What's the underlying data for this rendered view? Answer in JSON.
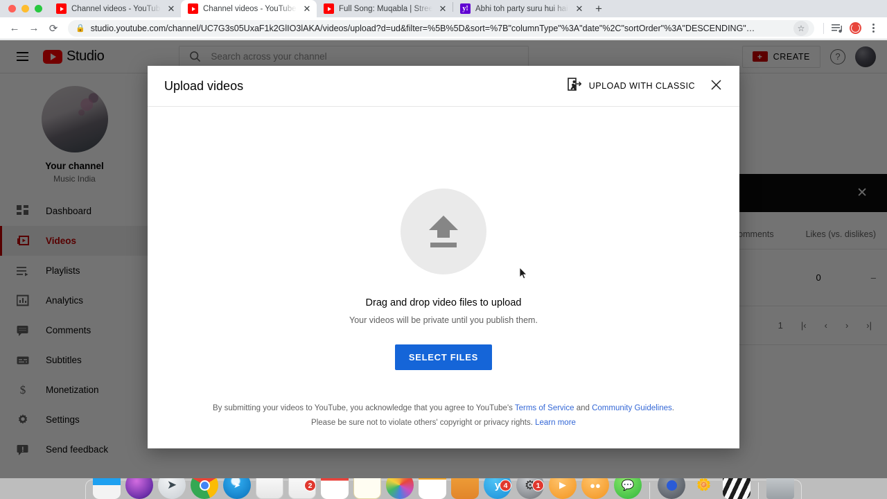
{
  "browser": {
    "tabs": [
      {
        "title": "Channel videos - YouTube Stud",
        "favicon": "youtube-icon",
        "active": false
      },
      {
        "title": "Channel videos - YouTube Stud",
        "favicon": "youtube-icon",
        "active": true
      },
      {
        "title": "Full Song: Muqabla | Street Dan",
        "favicon": "youtube-icon",
        "active": false
      },
      {
        "title": "Abhi toh party suru hui hai - Ya",
        "favicon": "yahoo-icon",
        "active": false
      }
    ],
    "new_tab_label": "+",
    "close_label": "✕",
    "back_label": "←",
    "forward_label": "→",
    "reload_label": "⟳",
    "url": "studio.youtube.com/channel/UC7G3s05UxaF1k2GlIO3lAKA/videos/upload?d=ud&filter=%5B%5D&sort=%7B\"columnType\"%3A\"date\"%2C\"sortOrder\"%3A\"DESCENDING\"…",
    "star_label": "☆",
    "reading_list_label": "☰",
    "profile_label": "",
    "menu_label": ""
  },
  "studio": {
    "logo_text": "Studio",
    "search_placeholder": "Search across your channel",
    "create_label": "CREATE",
    "help_label": "?",
    "channel": {
      "title": "Your channel",
      "name": "Music India"
    },
    "nav": [
      {
        "label": "Dashboard",
        "icon": "dashboard-icon",
        "active": false
      },
      {
        "label": "Videos",
        "icon": "video-icon",
        "active": true
      },
      {
        "label": "Playlists",
        "icon": "playlist-icon",
        "active": false
      },
      {
        "label": "Analytics",
        "icon": "analytics-icon",
        "active": false
      },
      {
        "label": "Comments",
        "icon": "comments-icon",
        "active": false
      },
      {
        "label": "Subtitles",
        "icon": "subtitles-icon",
        "active": false
      },
      {
        "label": "Monetization",
        "icon": "dollar-icon",
        "active": false
      },
      {
        "label": "Settings",
        "icon": "gear-icon",
        "active": false
      },
      {
        "label": "Send feedback",
        "icon": "feedback-icon",
        "active": false
      }
    ],
    "table": {
      "banner_close": "✕",
      "columns": [
        "Comments",
        "Likes (vs. dislikes)"
      ],
      "row": [
        "0",
        "–"
      ],
      "page_number": "1",
      "pager": [
        "|‹",
        "‹",
        "›",
        "›|"
      ]
    }
  },
  "modal": {
    "title": "Upload videos",
    "classic_label": "UPLOAD WITH CLASSIC",
    "classic_icon": "exit-to-app-icon",
    "close_icon": "close-icon",
    "upload_icon": "upload-arrow-icon",
    "drop_title": "Drag and drop video files to upload",
    "drop_subtitle": "Your videos will be private until you publish them.",
    "select_button": "SELECT FILES",
    "legal_line1_prefix": "By submitting your videos to YouTube, you acknowledge that you agree to YouTube's ",
    "legal_link_tos": "Terms of Service",
    "legal_line1_mid": " and ",
    "legal_link_guidelines": "Community Guidelines",
    "legal_line1_suffix": ".",
    "legal_line2_prefix": "Please be sure not to violate others' copyright or privacy rights. ",
    "legal_link_learn": "Learn more"
  },
  "dock": {
    "items": [
      {
        "name": "finder",
        "badge": null
      },
      {
        "name": "siri",
        "badge": null
      },
      {
        "name": "launchpad",
        "badge": null
      },
      {
        "name": "chrome",
        "badge": null
      },
      {
        "name": "safari",
        "badge": null
      },
      {
        "name": "notes-pad",
        "badge": null
      },
      {
        "name": "contacts",
        "badge": "2"
      },
      {
        "name": "calendar",
        "badge": null
      },
      {
        "name": "notes",
        "badge": null
      },
      {
        "name": "photos",
        "badge": null
      },
      {
        "name": "app-store",
        "badge": null
      },
      {
        "name": "folder",
        "badge": null
      },
      {
        "name": "yahoo-mail",
        "badge": "4"
      },
      {
        "name": "system-preferences",
        "badge": "1"
      },
      {
        "name": "vlc-orange",
        "badge": null
      },
      {
        "name": "firefox-orange",
        "badge": null
      },
      {
        "name": "messages",
        "badge": null
      },
      {
        "name": "downloads-stack",
        "badge": null
      },
      {
        "name": "flowers",
        "badge": null
      },
      {
        "name": "imovie",
        "badge": null
      },
      {
        "name": "trash",
        "badge": null
      }
    ]
  },
  "colors": {
    "accent_blue": "#1565d8",
    "youtube_red": "#ff0000",
    "studio_active": "#c00000",
    "link_blue": "#3367d6"
  }
}
